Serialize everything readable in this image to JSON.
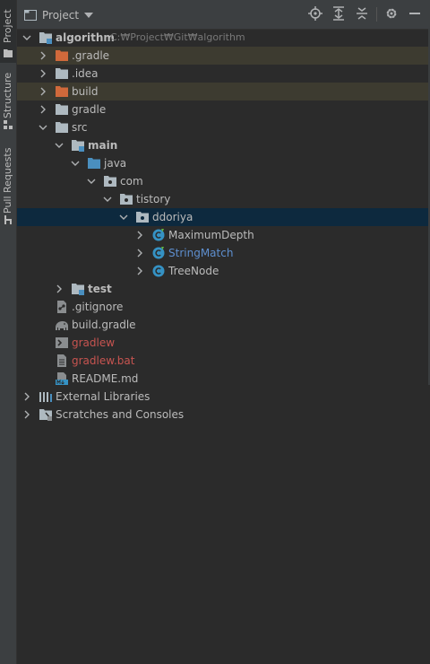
{
  "sidebar": {
    "project_label": "Project",
    "structure_label": "Structure",
    "pull_requests_label": "Pull Requests"
  },
  "header": {
    "title": "Project",
    "icons": [
      "folder-icon",
      "chevron-down-icon",
      "locate-icon",
      "expand-all-icon",
      "collapse-all-icon",
      "gear-icon",
      "minimize-icon"
    ]
  },
  "tree": {
    "root": {
      "label": "algorithm",
      "path": "C:₩Project₩Git₩algorithm"
    },
    "gradle_hidden": ".gradle",
    "idea": ".idea",
    "build": "build",
    "gradle": "gradle",
    "src": "src",
    "main": "main",
    "java": "java",
    "com": "com",
    "tistory": "tistory",
    "ddoriya": "ddoriya",
    "maximum_depth": "MaximumDepth",
    "string_match": "StringMatch",
    "tree_node": "TreeNode",
    "test": "test",
    "gitignore": ".gitignore",
    "build_gradle": "build.gradle",
    "gradlew": "gradlew",
    "gradlew_bat": "gradlew.bat",
    "readme": "README.md",
    "external_libraries": "External Libraries",
    "scratches": "Scratches and Consoles"
  },
  "colors": {
    "background": "#2b2b2b",
    "panel": "#3c3f41",
    "excluded_row": "#3d3b30",
    "selected_row": "#0d293e",
    "modified_text": "#5e8fcf",
    "unversioned_text": "#c75450",
    "excluded_folder": "#d0693b",
    "source_folder": "#4a8fbf",
    "folder": "#aeb9c0"
  }
}
